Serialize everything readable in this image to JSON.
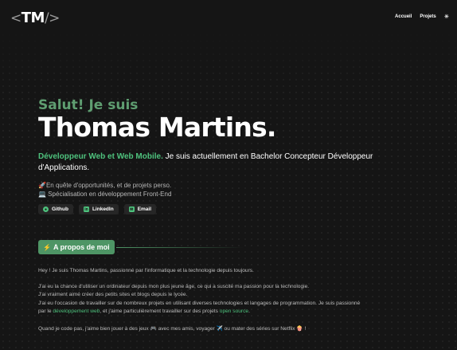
{
  "header": {
    "logo": "TM",
    "logo_left": "<",
    "logo_right": "/>",
    "nav": [
      {
        "label": "Accueil"
      },
      {
        "label": "Projets"
      }
    ],
    "theme_icon": "sun-icon"
  },
  "hero": {
    "greeting": "Salut! Je suis",
    "name": "Thomas Martins.",
    "role": "Développeur Web et Web Mobile.",
    "intro": " Je suis actuellement en Bachelor Concepteur Développeur d'Applications.",
    "points": [
      {
        "icon": "🚀",
        "text": "En quête d'opportunités, et de projets perso."
      },
      {
        "icon": "💻",
        "text": "Spécialisation en développement Front-End"
      }
    ],
    "socials": [
      {
        "label": "Github",
        "icon": "github-icon"
      },
      {
        "label": "LinkedIn",
        "icon": "linkedin-icon"
      },
      {
        "label": "Email",
        "icon": "mail-icon"
      }
    ]
  },
  "about": {
    "section_icon": "⚡",
    "section_title": "A propos de moi",
    "p1": "Hey ! Je suis Thomas Martins, passionné par l'informatique et la technologie depuis toujours.",
    "p2": "J'ai eu la chance d'utiliser un ordinateur depuis mon plus jeune âge, ce qui a suscité ma passion pour la technologie.",
    "p3": "J'ai vraiment aimé créer des petits sites et blogs depuis le lycée.",
    "p4": "J'ai eu l'occasion de travailler sur de nombreux projets en utilisant diverses technologies et langages de programmation. Je suis passionné",
    "p5_pre": "par le ",
    "p5_link": "développement web",
    "p5_mid": ", et j'aime particulièrement travailler sur des projets ",
    "p5_link2": "open source",
    "p5_end": ".",
    "p6": "Quand je code pas, j'aime bien jouer à des jeux 🎮 avec mes amis, voyager ✈️ ou mater des séries sur Netflix 🍿 !"
  },
  "colors": {
    "accent": "#4ec27d",
    "greeting": "#5f9e71",
    "badge": "#4e9565",
    "background": "#151515"
  }
}
